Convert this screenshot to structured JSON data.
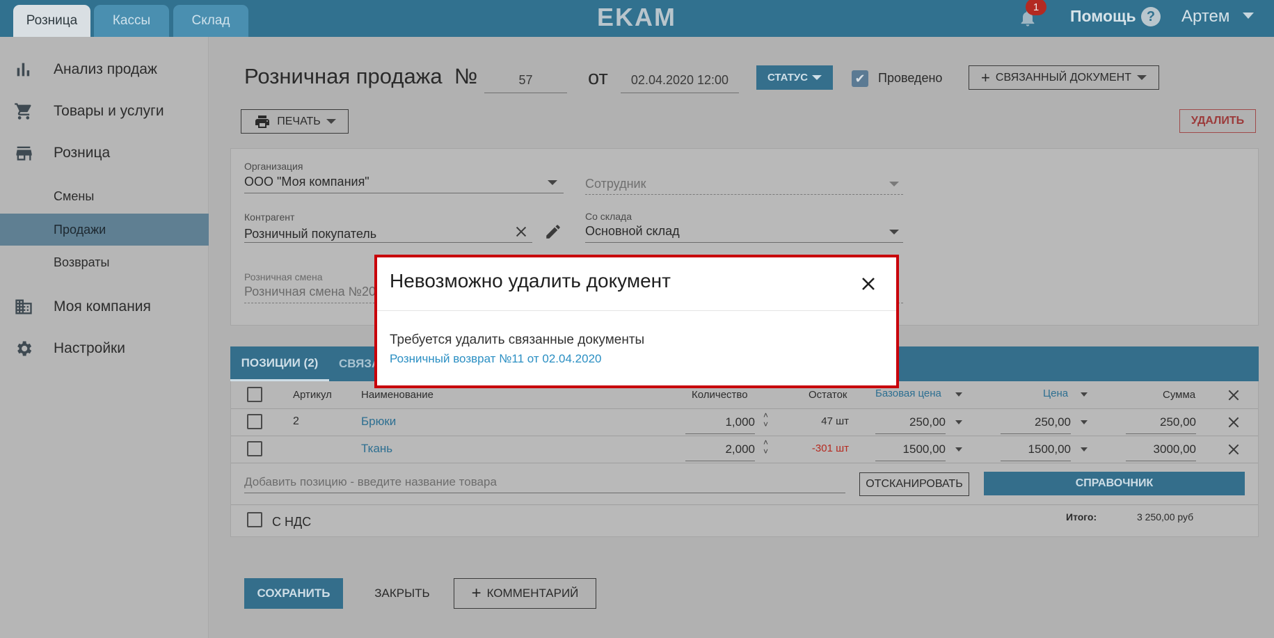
{
  "header": {
    "tabs": [
      {
        "label": "Розница",
        "active": true
      },
      {
        "label": "Кассы",
        "active": false
      },
      {
        "label": "Склад",
        "active": false
      }
    ],
    "logo": "EKAM",
    "notification_count": "1",
    "help_label": "Помощь",
    "help_icon_glyph": "?",
    "user_name": "Артем"
  },
  "sidebar": {
    "items": [
      {
        "label": "Анализ продаж",
        "icon": "bar-chart-icon"
      },
      {
        "label": "Товары и услуги",
        "icon": "cart-icon"
      },
      {
        "label": "Розница",
        "icon": "store-icon"
      },
      {
        "label": "Моя компания",
        "icon": "building-icon"
      },
      {
        "label": "Настройки",
        "icon": "gear-icon"
      }
    ],
    "sub_items": [
      {
        "label": "Смены",
        "active": false
      },
      {
        "label": "Продажи",
        "active": true
      },
      {
        "label": "Возвраты",
        "active": false
      }
    ]
  },
  "document": {
    "title": "Розничная продажа",
    "number_sign": "№",
    "number": "57",
    "from_label": "от",
    "date": "02.04.2020 12:00",
    "status_label": "СТАТУС",
    "posted_label": "Проведено",
    "posted": true,
    "linked_doc_label": "СВЯЗАННЫЙ ДОКУМЕНТ",
    "print_label": "ПЕЧАТЬ",
    "delete_label": "УДАЛИТЬ"
  },
  "form": {
    "organization_label": "Организация",
    "organization_value": "ООО \"Моя компания\"",
    "employee_placeholder": "Сотрудник",
    "counterparty_label": "Контрагент",
    "counterparty_value": "Розничный покупатель",
    "warehouse_label": "Со склада",
    "warehouse_value": "Основной склад",
    "shift_label": "Розничная смена",
    "shift_value": "Розничная смена №20"
  },
  "positions": {
    "tabs": [
      {
        "label": "ПОЗИЦИИ (2)",
        "active": true
      },
      {
        "label": "СВЯЗА",
        "active": false
      }
    ],
    "columns": {
      "article": "Артикул",
      "name": "Наименование",
      "quantity": "Количество",
      "stock": "Остаток",
      "base_price": "Базовая цена",
      "price": "Цена",
      "sum": "Сумма"
    },
    "rows": [
      {
        "article": "2",
        "name": "Брюки",
        "quantity": "1,000",
        "stock": "47 шт",
        "stock_negative": false,
        "base_price": "250,00",
        "price": "250,00",
        "sum": "250,00"
      },
      {
        "article": "",
        "name": "Ткань",
        "quantity": "2,000",
        "stock": "-301 шт",
        "stock_negative": true,
        "base_price": "1500,00",
        "price": "1500,00",
        "sum": "3000,00"
      }
    ],
    "add_placeholder": "Добавить позицию - введите название товара",
    "scan_label": "ОТСКАНИРОВАТЬ",
    "catalog_label": "СПРАВОЧНИК",
    "vat_label": "С НДС",
    "total_label": "Итого:",
    "total_value": "3 250,00 руб"
  },
  "footer": {
    "save_label": "СОХРАНИТЬ",
    "close_label": "ЗАКРЫТЬ",
    "comment_label": "КОММЕНТАРИЙ"
  },
  "modal": {
    "title": "Невозможно удалить документ",
    "message": "Требуется удалить связанные документы",
    "link_text": "Розничный возврат №11 от 02.04.2020"
  },
  "colors": {
    "topbar": "#31718f",
    "accent": "#346e8b",
    "modal_border": "#c8000a",
    "link": "#2b8fc3",
    "negative": "#b52a20"
  }
}
